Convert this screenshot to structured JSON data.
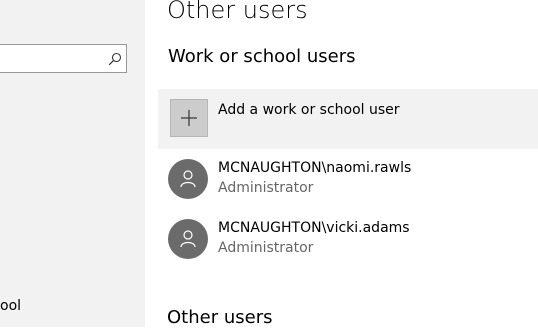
{
  "sidebar": {
    "search": {
      "value": "",
      "placeholder": ""
    },
    "cut_text": "ool"
  },
  "main": {
    "page_title": "Other users",
    "work_section": {
      "title": "Work or school users",
      "add_label": "Add a work or school user",
      "users": [
        {
          "name": "MCNAUGHTON\\naomi.rawls",
          "role": "Administrator"
        },
        {
          "name": "MCNAUGHTON\\vicki.adams",
          "role": "Administrator"
        }
      ]
    },
    "other_section": {
      "title": "Other users"
    }
  },
  "colors": {
    "sidebar_bg": "#f2f2f2",
    "avatar_bg": "#6b6b6b",
    "add_tile_bg": "#cccccc",
    "secondary_text": "#666666"
  },
  "icons": {
    "search": "search-icon",
    "add": "plus-icon",
    "user": "person-icon"
  }
}
